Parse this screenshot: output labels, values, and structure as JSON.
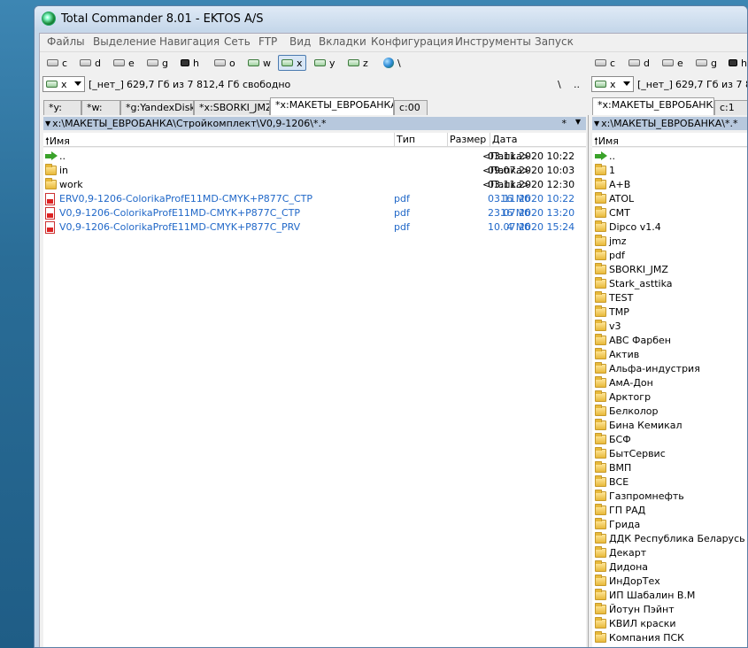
{
  "window": {
    "title": "Total Commander 8.01 - EKTOS A/S"
  },
  "menu": [
    "Файлы",
    "Выделение",
    "Навигация",
    "Сеть",
    "FTP",
    "Вид",
    "Вкладки",
    "Конфигурация",
    "Инструменты",
    "Запуск"
  ],
  "left_drives": [
    {
      "letter": "c",
      "type": "disk"
    },
    {
      "letter": "d",
      "type": "disk"
    },
    {
      "letter": "e",
      "type": "disk"
    },
    {
      "letter": "g",
      "type": "disk"
    },
    {
      "letter": "h",
      "type": "camera"
    },
    {
      "letter": "o",
      "type": "disk"
    },
    {
      "letter": "w",
      "type": "net"
    },
    {
      "letter": "x",
      "type": "net",
      "active": true
    },
    {
      "letter": "y",
      "type": "net"
    },
    {
      "letter": "z",
      "type": "net"
    },
    {
      "letter": "\\",
      "type": "network-neighborhood"
    }
  ],
  "right_drives": [
    {
      "letter": "c",
      "type": "disk"
    },
    {
      "letter": "d",
      "type": "disk"
    },
    {
      "letter": "e",
      "type": "disk"
    },
    {
      "letter": "g",
      "type": "disk"
    },
    {
      "letter": "h",
      "type": "camera"
    }
  ],
  "left": {
    "drive_combo": "x",
    "volume_label": "[_нет_]",
    "free_space": "629,7 Гб из 7 812,4 Гб свободно",
    "root_button": "\\",
    "up_button": "..",
    "tabs": [
      "*y:",
      "*w:",
      "*g:YandexDisk",
      "*x:SBORKI_JMZ",
      "*x:МАКЕТЫ_ЕВРОБАНКА",
      "c:00"
    ],
    "active_tab": 4,
    "path": "x:\\МАКЕТЫ_ЕВРОБАНКА\\Стройкомплект\\V0,9-1206\\*.*",
    "filter": "*",
    "columns": {
      "name": "Имя",
      "type": "Тип",
      "size": "Размер",
      "date": "Дата"
    },
    "files": [
      {
        "icon": "up",
        "name": "..",
        "type": "",
        "size": "<Папка>",
        "date": "03.11.2020 10:22"
      },
      {
        "icon": "folder",
        "name": "in",
        "type": "",
        "size": "<Папка>",
        "date": "09.07.2020 10:03"
      },
      {
        "icon": "folder",
        "name": "work",
        "type": "",
        "size": "<Папка>",
        "date": "03.11.2020 12:30"
      },
      {
        "icon": "pdf",
        "name": "ERV0,9-1206-ColorikaProfE11MD-CMYK+P877C_CTP",
        "type": "pdf",
        "size": "16 Мб",
        "date": "03.11.2020 10:22"
      },
      {
        "icon": "pdf",
        "name": "V0,9-1206-ColorikaProfE11MD-CMYK+P877C_CTP",
        "type": "pdf",
        "size": "16 Мб",
        "date": "23.07.2020 13:20"
      },
      {
        "icon": "pdf",
        "name": "V0,9-1206-ColorikaProfE11MD-CMYK+P877C_PRV",
        "type": "pdf",
        "size": "4 Мб",
        "date": "10.07.2020 15:24"
      }
    ]
  },
  "right": {
    "drive_combo": "x",
    "volume_label": "[_нет_]",
    "free_space": "629,7 Гб из 7 8",
    "tabs": [
      "*x:МАКЕТЫ_ЕВРОБАНКА",
      "c:1"
    ],
    "active_tab": 0,
    "path": "x:\\МАКЕТЫ_ЕВРОБАНКА\\*.*",
    "columns": {
      "name": "Имя"
    },
    "files": [
      {
        "icon": "up",
        "name": ".."
      },
      {
        "icon": "folder",
        "name": "1"
      },
      {
        "icon": "folder",
        "name": "A+B"
      },
      {
        "icon": "folder",
        "name": "ATOL"
      },
      {
        "icon": "folder",
        "name": "CMT"
      },
      {
        "icon": "folder",
        "name": "Dipco v1.4"
      },
      {
        "icon": "folder",
        "name": "jmz"
      },
      {
        "icon": "folder",
        "name": "pdf"
      },
      {
        "icon": "folder",
        "name": "SBORKI_JMZ"
      },
      {
        "icon": "folder",
        "name": "Stark_asttika"
      },
      {
        "icon": "folder",
        "name": "TEST"
      },
      {
        "icon": "folder",
        "name": "TMP"
      },
      {
        "icon": "folder",
        "name": "v3"
      },
      {
        "icon": "folder",
        "name": "ABC Фарбен"
      },
      {
        "icon": "folder",
        "name": "Актив"
      },
      {
        "icon": "folder",
        "name": "Альфа-индустрия"
      },
      {
        "icon": "folder",
        "name": "АмА-Дон"
      },
      {
        "icon": "folder",
        "name": "Арктогр"
      },
      {
        "icon": "folder",
        "name": "Белколор"
      },
      {
        "icon": "folder",
        "name": "Бина Кемикал"
      },
      {
        "icon": "folder",
        "name": "БСФ"
      },
      {
        "icon": "folder",
        "name": "БытСервис"
      },
      {
        "icon": "folder",
        "name": "ВМП"
      },
      {
        "icon": "folder",
        "name": "ВСЕ"
      },
      {
        "icon": "folder",
        "name": "Газпромнефть"
      },
      {
        "icon": "folder",
        "name": "ГП РАД"
      },
      {
        "icon": "folder",
        "name": "Грида"
      },
      {
        "icon": "folder",
        "name": "ДДК Республика Беларусь"
      },
      {
        "icon": "folder",
        "name": "Декарт"
      },
      {
        "icon": "folder",
        "name": "Дидона"
      },
      {
        "icon": "folder",
        "name": "ИнДорТех"
      },
      {
        "icon": "folder",
        "name": "ИП Шабалин В.М"
      },
      {
        "icon": "folder",
        "name": "Йотун Пэйнт"
      },
      {
        "icon": "folder",
        "name": "КВИЛ краски"
      },
      {
        "icon": "folder",
        "name": "Компания ПСК"
      }
    ]
  },
  "colors": {
    "pdf_text": "#2168c8",
    "path_bar": "#b7c8dd",
    "window_frame": "#c6d7e9"
  }
}
